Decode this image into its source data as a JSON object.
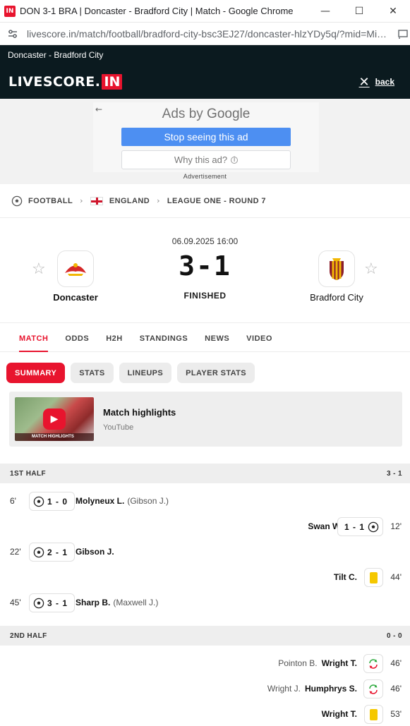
{
  "browser": {
    "window_title": "DON 3-1 BRA | Doncaster - Bradford City | Match - Google Chrome",
    "favicon_text": "IN",
    "url": "livescore.in/match/football/bradford-city-bsc3EJ27/doncaster-hlzYDy5q/?mid=Mi…",
    "controls": {
      "minimize": "—",
      "maximize": "☐",
      "close": "✕"
    }
  },
  "site": {
    "sub_title": "Doncaster - Bradford City",
    "logo_text": "LIVESCORE.",
    "logo_badge": "IN",
    "back_label": "back"
  },
  "ad": {
    "ads_by": "Ads by ",
    "google": "Google",
    "stop_label": "Stop seeing this ad",
    "why_label": "Why this ad?",
    "info_glyph": "i",
    "caption": "Advertisement"
  },
  "breadcrumb": {
    "sport": "FOOTBALL",
    "country": "ENGLAND",
    "league": "LEAGUE ONE - ROUND 7"
  },
  "match": {
    "date": "06.09.2025 16:00",
    "score": "3-1",
    "status": "FINISHED",
    "home": {
      "name": "Doncaster"
    },
    "away": {
      "name": "Bradford City"
    }
  },
  "tabs": [
    "MATCH",
    "ODDS",
    "H2H",
    "STANDINGS",
    "NEWS",
    "VIDEO"
  ],
  "subtabs": [
    "SUMMARY",
    "STATS",
    "LINEUPS",
    "PLAYER STATS"
  ],
  "highlights": {
    "title": "Match highlights",
    "source": "YouTube",
    "thumb_caption": "MATCH HIGHLIGHTS"
  },
  "periods": [
    {
      "name": "1ST HALF",
      "score": "3 - 1"
    },
    {
      "name": "2ND HALF",
      "score": "0 - 0"
    }
  ],
  "first_half_events": [
    {
      "side": "home",
      "minute": "6'",
      "type": "goal",
      "score": "1 - 0",
      "player": "Molyneux L.",
      "assist": "(Gibson J.)"
    },
    {
      "side": "away",
      "minute": "12'",
      "type": "goal",
      "score": "1 - 1",
      "player": "Swan W.",
      "assist": ""
    },
    {
      "side": "home",
      "minute": "22'",
      "type": "goal",
      "score": "2 - 1",
      "player": "Gibson J.",
      "assist": ""
    },
    {
      "side": "away",
      "minute": "44'",
      "type": "yellow",
      "player": "Tilt C.",
      "assist": ""
    },
    {
      "side": "home",
      "minute": "45'",
      "type": "goal",
      "score": "3 - 1",
      "player": "Sharp B.",
      "assist": "(Maxwell J.)"
    }
  ],
  "second_half_events": [
    {
      "side": "away",
      "minute": "46'",
      "type": "sub",
      "player": "Wright T.",
      "assist": "Pointon B."
    },
    {
      "side": "away",
      "minute": "46'",
      "type": "sub",
      "player": "Humphrys S.",
      "assist": "Wright J."
    },
    {
      "side": "away",
      "minute": "53'",
      "type": "yellow",
      "player": "Wright T.",
      "assist": ""
    }
  ],
  "colors": {
    "accent": "#e8142e",
    "header_bg": "#0b1a1f",
    "yellow_card": "#f5c800"
  },
  "icons": {
    "soccer_ball": "soccer-ball-icon",
    "substitution": "substitution-icon",
    "yellow_card": "yellow-card-icon",
    "star": "favorite-star-icon"
  }
}
